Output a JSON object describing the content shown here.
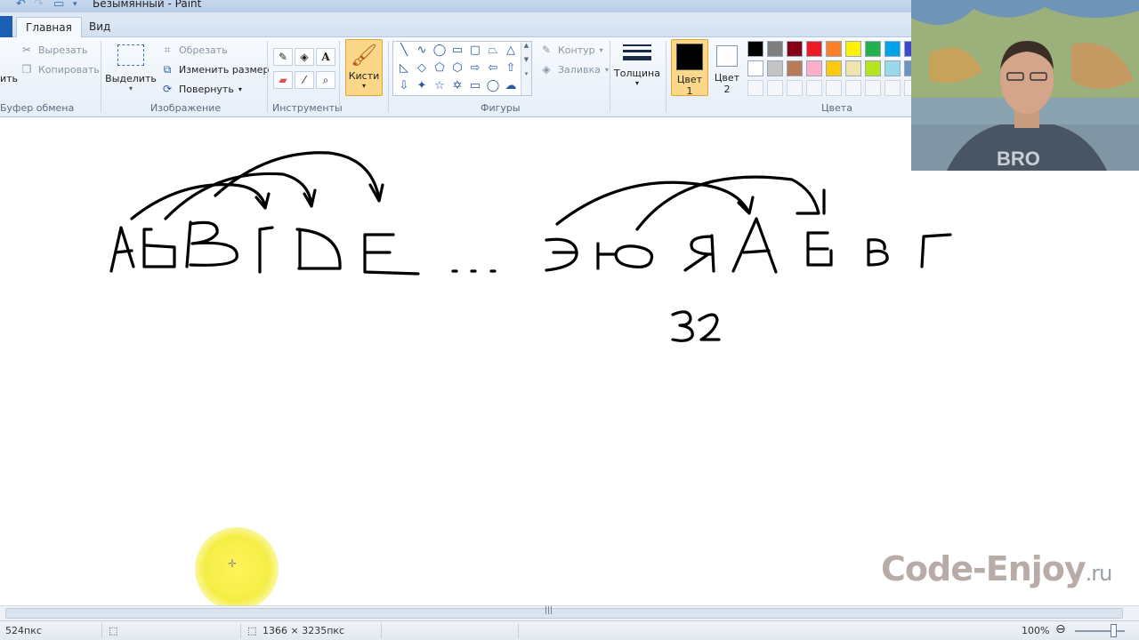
{
  "window": {
    "title": "Безымянный - Paint"
  },
  "tabs": [
    {
      "label": "Главная",
      "active": true
    },
    {
      "label": "Вид",
      "active": false
    }
  ],
  "ribbon": {
    "clipboard": {
      "paste_partial": "ить",
      "cut": "Вырезать",
      "copy": "Копировать",
      "label_partial": "Буфер обмена"
    },
    "image": {
      "select": "Выделить",
      "crop": "Обрезать",
      "resize": "Изменить размер",
      "rotate": "Повернуть",
      "label": "Изображение"
    },
    "tools": {
      "label": "Инструменты"
    },
    "brushes": {
      "label": "Кисти"
    },
    "shapes": {
      "outline": "Контур",
      "fill": "Заливка",
      "label": "Фигуры"
    },
    "size": {
      "label": "Толщина"
    },
    "color1": {
      "label": "Цвет",
      "num": "1",
      "value": "#000000"
    },
    "color2": {
      "label": "Цвет",
      "num": "2",
      "value": "#ffffff"
    },
    "colors": {
      "label": "Цвета",
      "row1": [
        "#000000",
        "#7f7f7f",
        "#880015",
        "#ed1c24",
        "#ff7f27",
        "#fff200",
        "#22b14c",
        "#00a2e8",
        "#3f48cc"
      ],
      "row2": [
        "#ffffff",
        "#c3c3c3",
        "#b97a57",
        "#ffaec9",
        "#ffc90e",
        "#efe4b0",
        "#b5e61d",
        "#99d9ea",
        "#7092be"
      ]
    }
  },
  "canvas": {
    "number_note": "32"
  },
  "watermark": {
    "brand": "Code-Enjoy",
    "tld": ".ru"
  },
  "status": {
    "position": "524пкс",
    "size": "1366 × 3235пкс",
    "zoom": "100%"
  }
}
